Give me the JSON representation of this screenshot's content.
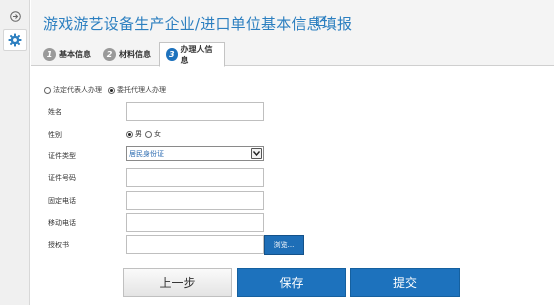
{
  "page": {
    "title": "游戏游艺设备生产企业/进口单位基本信息填报",
    "title_color": "#2c7fc0",
    "accent_color": "#1d72bd"
  },
  "sidebar": {
    "icons": [
      "collapse-arrow-icon",
      "gear-icon"
    ]
  },
  "tabs": [
    {
      "num": "1",
      "label": "基本信息",
      "active": false
    },
    {
      "num": "2",
      "label": "材料信息",
      "active": false
    },
    {
      "num": "3",
      "label": "办理人信息",
      "active": true
    }
  ],
  "handler_type": {
    "options": [
      "法定代表人办理",
      "委托代理人办理"
    ],
    "selected": "委托代理人办理"
  },
  "form": {
    "name_label": "姓名",
    "name_value": "",
    "gender_label": "性别",
    "gender_options": [
      "男",
      "女"
    ],
    "gender_selected": "男",
    "id_type_label": "证件类型",
    "id_type_value": "居民身份证",
    "id_number_label": "证件号码",
    "id_number_value": "",
    "phone_label": "固定电话",
    "phone_value": "",
    "mobile_label": "移动电话",
    "mobile_value": "",
    "auth_label": "授权书",
    "auth_value": "",
    "browse_label": "浏览..."
  },
  "actions": {
    "prev": "上一步",
    "save": "保存",
    "submit": "提交"
  }
}
